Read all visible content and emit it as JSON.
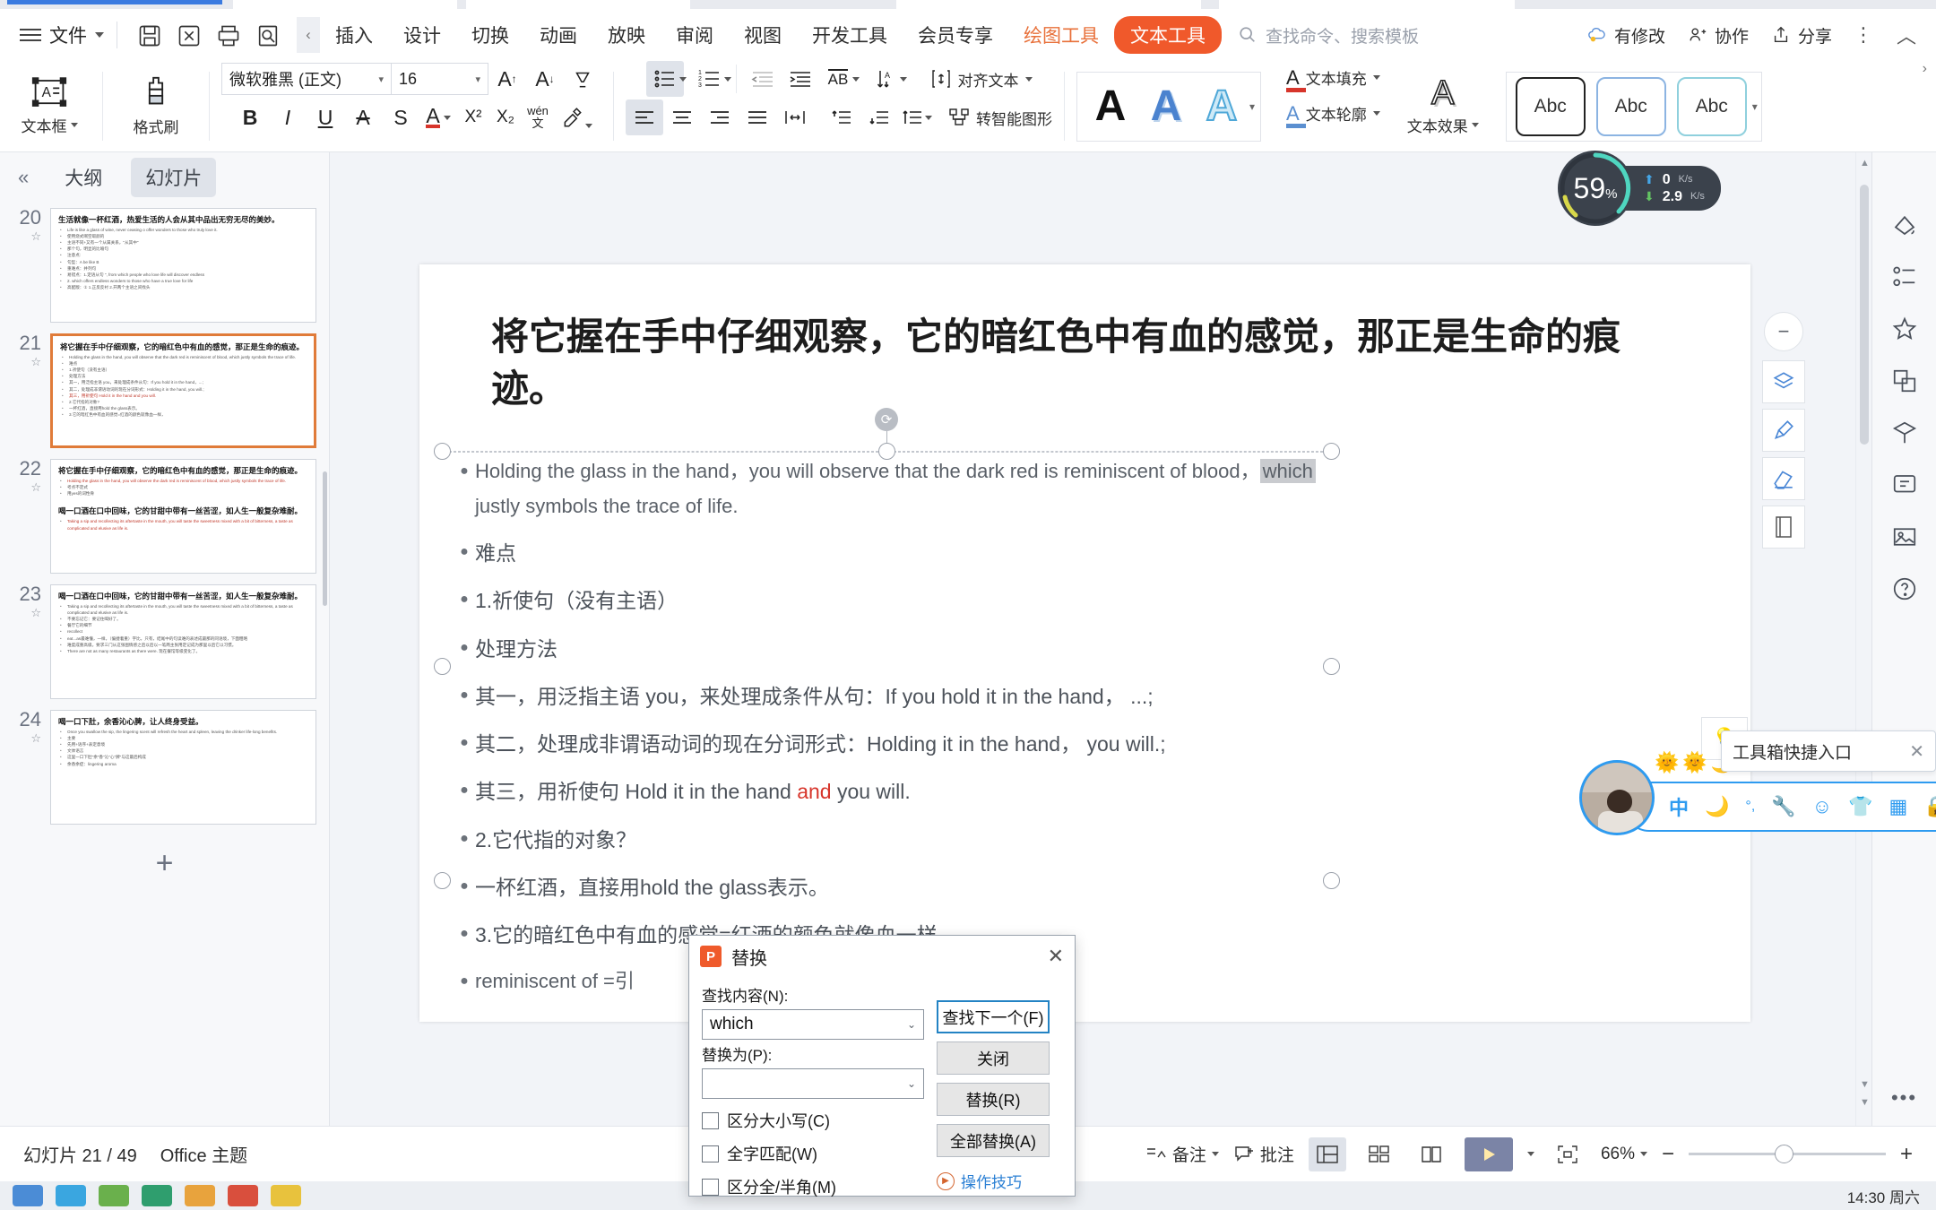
{
  "menubar": {
    "file_label": "文件",
    "quick_icons": [
      "save-icon",
      "save-as-icon",
      "print-icon",
      "print-preview-icon"
    ],
    "collapse_glyph": "‹",
    "tabs": [
      "插入",
      "设计",
      "切换",
      "动画",
      "放映",
      "审阅",
      "视图",
      "开发工具",
      "会员专享"
    ],
    "context_tab_draw": "绘图工具",
    "context_tab_text": "文本工具",
    "search_placeholder": "查找命令、搜索模板",
    "right_items": [
      {
        "label": "有修改",
        "icon": "cloud-modified-icon"
      },
      {
        "label": "协作",
        "icon": "collaborate-icon"
      },
      {
        "label": "分享",
        "icon": "share-icon"
      }
    ],
    "more_glyph": "⋮",
    "collapse_ribbon_glyph": "︿"
  },
  "ribbon": {
    "textbox_label": "文本框",
    "format_painter_label": "格式刷",
    "font_name": "微软雅黑 (正文)",
    "font_size": "16",
    "grow_font": "A↑",
    "shrink_font": "A↓",
    "clear_format": "clear-format-icon",
    "bold": "B",
    "italic": "I",
    "underline": "U",
    "strikethrough": "A",
    "shadow": "S",
    "char_border": "A",
    "superscript": "X²",
    "subscript": "X₂",
    "phonetic": "wén 文",
    "highlight": "highlight-icon",
    "bullets": "bullets-icon",
    "numbering": "numbering-icon",
    "decrease_indent": "decrease-indent-icon",
    "increase_indent": "increase-indent-icon",
    "text_direction": "AB",
    "sort": "sort-icon",
    "align_text_label": "对齐文本",
    "align_left": "align-left-icon",
    "align_center": "align-center-icon",
    "align_right": "align-right-icon",
    "align_justify": "align-justify-icon",
    "distribute": "distribute-icon",
    "line_spacing_up": "space-before-icon",
    "line_spacing_down": "space-after-icon",
    "line_spacing": "line-spacing-icon",
    "smartart_label": "转智能图形",
    "wordart_letters": [
      "A",
      "A",
      "A"
    ],
    "text_fill_label": "文本填充",
    "text_outline_label": "文本轮廓",
    "text_effect_label": "文本效果",
    "shape_styles": [
      "Abc",
      "Abc",
      "Abc"
    ]
  },
  "left_panel": {
    "collapse_glyph": "«",
    "tab_outline": "大纲",
    "tab_slides": "幻灯片",
    "add_slide_glyph": "+",
    "slides": [
      {
        "number": "20",
        "title": "生活就像一杯红酒，热爱生活的人会从其中品出无穷无尽的美妙。",
        "lines": [
          {
            "t": "Life is like a glass of wine, never ceasing o offer wonders to those who truly love it.",
            "c": "g"
          },
          {
            "t": "使用烧式啊空取颜的",
            "c": "g"
          },
          {
            "t": "主语不同+又有一个从属关系，\"从其中\"",
            "c": "g"
          },
          {
            "t": "那个句，明显的比喻句",
            "c": "g"
          },
          {
            "t": "注意点:",
            "c": "g"
          },
          {
            "t": "句型：A be like B",
            "c": "g"
          },
          {
            "t": "重难点：并列句",
            "c": "g"
          },
          {
            "t": "易错点：1.定语从句 \", from which people who love life will discover endless",
            "c": "g"
          },
          {
            "t": "2. which offers endless wonders to those who have a true love for life",
            "c": "g"
          },
          {
            "t": "高配版：① 1.正反反衬  2.开两个主语之间找头",
            "c": "g"
          }
        ]
      },
      {
        "number": "21",
        "title": "将它握在手中仔细观察，它的暗红色中有血的感觉，那正是生命的痕迹。",
        "selected": true,
        "lines": [
          {
            "t": "Holding the glass in the hand, you will observe that the dark red is reminiscent of blood, which justly symbols the trace of life.",
            "c": "g"
          },
          {
            "t": "难点",
            "c": "g"
          },
          {
            "t": "1.祈使句（没有主语）",
            "c": "g"
          },
          {
            "t": "处理方法",
            "c": "g"
          },
          {
            "t": "其一，用泛指主语 you，来处理成条件从句：If you hold it in the hand，...;",
            "c": "g"
          },
          {
            "t": "其二，处理成非谓语动词的现在分词形式：Holding it in the hand, you will.;",
            "c": "g"
          },
          {
            "t": "其三，用祈使句 Hold it in the hand and you will.",
            "c": "r"
          },
          {
            "t": "2.它代指的对象?",
            "c": "g"
          },
          {
            "t": "一杯红酒，直接用hold the glass表示。",
            "c": "g"
          },
          {
            "t": "3.它的暗红色中有血的感觉=红酒的颜色就像血一样，",
            "c": "g"
          }
        ]
      },
      {
        "number": "22",
        "title": "将它握在手中仔细观察，它的暗红色中有血的感觉，那正是生命的痕迹。",
        "lines": [
          {
            "t": "Holding the glass in the hand, you will observe the dark red is reminiscent of blood, which justly symbols the trace of life.",
            "c": "r"
          },
          {
            "t": "考点不定式",
            "c": "g"
          },
          {
            "t": "用yes的词性骨",
            "c": "g"
          }
        ],
        "title2": "喝一口酒在口中回味，它的甘甜中带有一丝苦涩，如人生一般复杂难耐。",
        "lines2": [
          {
            "t": "Taking a sip and recollecting its aftertaste in the mouth, you will taste the sweetness mixed with a bit of bitterness, a taste as complicated and elusive as life is.",
            "c": "r"
          }
        ]
      },
      {
        "number": "23",
        "title": "喝一口酒在口中回味，它的甘甜中带有一丝苦涩，如人生一般复杂难耐。",
        "lines": [
          {
            "t": "Taking a sip and recollecting its aftertaste in the mouth, you will taste the sweetness mixed with a bit of bitterness, a taste as complicated and elusive as life is.",
            "c": "g"
          },
          {
            "t": "不要忘记它：要记住喝好了。",
            "c": "g"
          },
          {
            "t": "餐厅它的细节",
            "c": "g"
          },
          {
            "t": "recollect",
            "c": "g"
          },
          {
            "t": "eat...as最难懂，一样，（偏捷着重）字比，只有，结尾中的句读难的表述成最那的同语境，下面粗略",
            "c": "g"
          },
          {
            "t": "难度成重高级。要求三门从这张图情感之后以后以一笔两主张用定记成为那里以后它以习惯。",
            "c": "g"
          },
          {
            "t": "There are not as many restaurants as there were. 现在餐馆等级变化了。",
            "c": "g"
          }
        ]
      },
      {
        "number": "24",
        "title": "喝一口下肚，余香沁心脾，让人终身受益。",
        "lines": [
          {
            "t": "Once you swallow the sip, the lingering scent will refresh the heart and spleen, leaving the drinker life-long benefits.",
            "c": "g"
          },
          {
            "t": "主要",
            "c": "g"
          },
          {
            "t": "先用+语序+表定意境",
            "c": "g"
          },
          {
            "t": "文体语言",
            "c": "g"
          },
          {
            "t": "这里一口下肚\"余\"香\"沁\"心\"脾\"与这最后构成",
            "c": "g"
          },
          {
            "t": "余香余症：lingering aroma",
            "c": "g"
          }
        ]
      }
    ]
  },
  "slide": {
    "title": "将它握在手中仔细观察，它的暗红色中有血的感觉，那正是生命的痕迹。",
    "rotate_icon": "rotate-handle-icon",
    "body": [
      {
        "type": "en",
        "pre": "Holding the glass in the hand，you will observe that the dark red is reminiscent of blood，",
        "hl": "which",
        "post": "",
        "second_line": "justly symbols the trace of life."
      },
      {
        "type": "zh",
        "text": "难点"
      },
      {
        "type": "zh",
        "text": "1.祈使句（没有主语）"
      },
      {
        "type": "zh",
        "text": "处理方法"
      },
      {
        "type": "zh",
        "text": "其一，用泛指主语 you，来处理成条件从句：If you hold it in the hand， ...;"
      },
      {
        "type": "zh",
        "text": "其二，处理成非谓语动词的现在分词形式：Holding it in the hand， you will.;"
      },
      {
        "type": "zh",
        "text": "其三，用祈使句 Hold it in the hand ",
        "red": "and",
        "tail": " you will."
      },
      {
        "type": "zh",
        "text": "2.它代指的对象？"
      },
      {
        "type": "zh",
        "text": "一杯红酒，直接用hold the glass表示。"
      },
      {
        "type": "zh",
        "text": "3.它的暗红色中有血的感觉=红酒的颜色就像血一样，"
      },
      {
        "type": "en",
        "text": "reminiscent of =引"
      }
    ]
  },
  "right_rail": {
    "items": [
      {
        "icon": "shape-fill-icon"
      },
      {
        "icon": "align-objects-icon"
      },
      {
        "icon": "star-effects-icon"
      },
      {
        "icon": "layers-panel-icon"
      },
      {
        "icon": "selection-pane-icon"
      },
      {
        "icon": "design-ideas-icon"
      },
      {
        "icon": "image-library-icon"
      },
      {
        "icon": "help-icon"
      }
    ],
    "canvas_tools": [
      {
        "icon": "zoom-out-circle-icon"
      },
      {
        "icon": "layers-stack-icon"
      },
      {
        "icon": "brush-icon"
      },
      {
        "icon": "eraser-icon"
      },
      {
        "icon": "page-icon"
      },
      {
        "icon": "lightbulb-icon"
      }
    ],
    "more_glyph": "•••"
  },
  "net_monitor": {
    "percent": "59",
    "percent_sign": "%",
    "upload": "0",
    "upload_unit": "K/s",
    "download": "2.9",
    "download_unit": "K/s"
  },
  "quick_toolbar": {
    "tooltip": "工具箱快捷入口",
    "close_glyph": "✕",
    "icons": [
      "中",
      "moon-icon",
      "ime-punctuation-icon",
      "wrench-icon",
      "smiley-icon",
      "skin-icon",
      "apps-grid-icon",
      "lock-icon"
    ],
    "weather_icons": [
      "sun-icon",
      "sun-icon",
      "moon-icon"
    ],
    "bulb_icon": "lightbulb-icon"
  },
  "dialog": {
    "title": "替换",
    "logo_letter": "P",
    "close_glyph": "✕",
    "find_label": "查找内容(N):",
    "find_value": "which",
    "replace_label": "替换为(P):",
    "replace_value": "",
    "checkboxes": [
      {
        "label": "区分大小写(C)",
        "checked": false
      },
      {
        "label": "全字匹配(W)",
        "checked": false
      },
      {
        "label": "区分全/半角(M)",
        "checked": false
      }
    ],
    "buttons": [
      {
        "label": "查找下一个(F)",
        "primary": true
      },
      {
        "label": "关闭",
        "primary": false
      },
      {
        "label": "替换(R)",
        "primary": false
      },
      {
        "label": "全部替换(A)",
        "primary": false
      }
    ],
    "tip_label": "操作技巧"
  },
  "statusbar": {
    "slide_counter": "幻灯片 21 / 49",
    "theme": "Office 主题",
    "notes_label": "备注",
    "comments_label": "批注",
    "view_normal": "normal-view-icon",
    "view_sorter": "slide-sorter-icon",
    "view_reading": "reading-view-icon",
    "play_icon": "play-icon",
    "fit_icon": "fit-slide-icon",
    "zoom_level": "66%",
    "zoom_out": "−",
    "zoom_in": "+"
  },
  "taskbar": {
    "clock_time": "14:30",
    "clock_day": "周六"
  }
}
